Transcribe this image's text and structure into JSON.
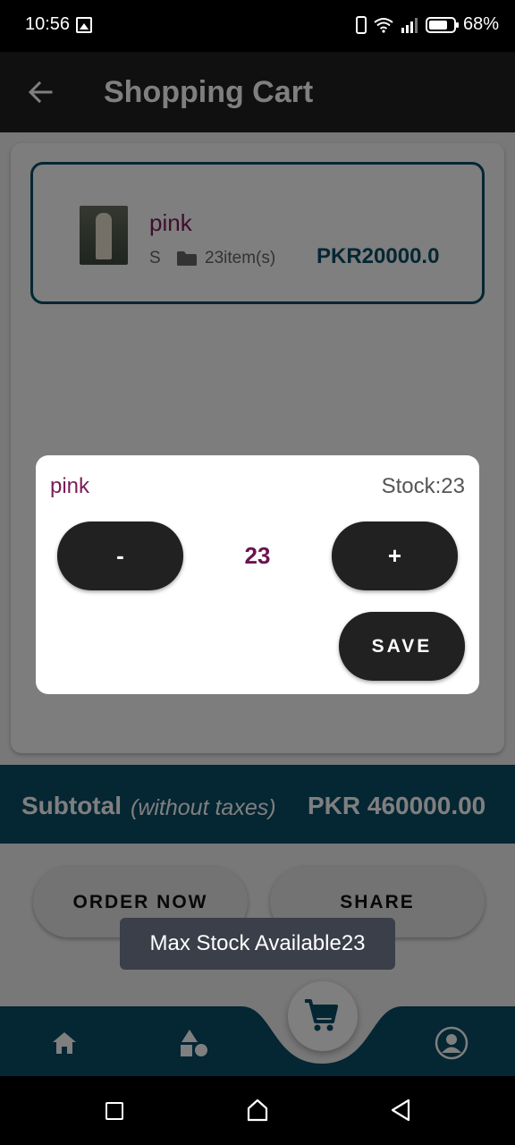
{
  "status_bar": {
    "time": "10:56",
    "battery": "68%",
    "icons": [
      "image-icon",
      "phone-icon",
      "wifi-icon",
      "signal-icon",
      "battery-icon"
    ]
  },
  "app_bar": {
    "back_icon": "arrow-left-icon",
    "title": "Shopping Cart"
  },
  "cart_items": [
    {
      "name": "pink",
      "size": "S",
      "quantity_text": "23item(s)",
      "price": "PKR20000.0"
    }
  ],
  "subtotal": {
    "label": "Subtotal",
    "note": "(without taxes)",
    "value": "PKR 460000.00"
  },
  "actions": {
    "order_label": "ORDER NOW",
    "share_label": "SHARE"
  },
  "bottom_nav": {
    "items": [
      "home-icon",
      "shapes-icon",
      "cart-icon",
      "profile-icon"
    ]
  },
  "dialog": {
    "item_name": "pink",
    "stock": "Stock:23",
    "decrement_label": "-",
    "increment_label": "+",
    "quantity": "23",
    "save_label": "SAVE"
  },
  "toast": {
    "message": "Max Stock Available23"
  },
  "colors": {
    "accent_teal": "#0b4d66",
    "product_name": "#7a1c5a",
    "button_dark": "#212121"
  }
}
